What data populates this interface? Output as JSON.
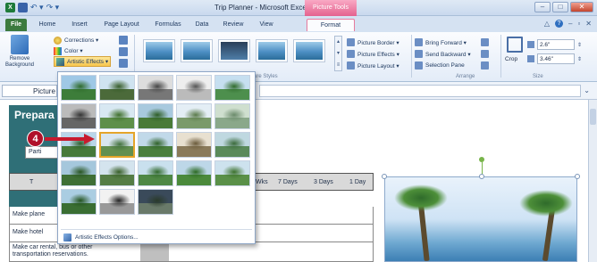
{
  "window": {
    "title": "Trip Planner - Microsoft Excel",
    "context_tab": "Picture Tools",
    "logo_letter": "X"
  },
  "tabs": [
    {
      "label": "File"
    },
    {
      "label": "Home"
    },
    {
      "label": "Insert"
    },
    {
      "label": "Page Layout"
    },
    {
      "label": "Formulas"
    },
    {
      "label": "Data"
    },
    {
      "label": "Review"
    },
    {
      "label": "View"
    },
    {
      "label": "Format"
    }
  ],
  "ribbon": {
    "remove_background": {
      "line1": "Remove",
      "line2": "Background"
    },
    "adjust": {
      "corrections": "Corrections ▾",
      "color": "Color ▾",
      "artistic_effects": "Artistic Effects ▾"
    },
    "styles_label": "ure Styles",
    "arrange_label": "Arrange",
    "size_label": "Size",
    "picture_border": "Picture Border ▾",
    "picture_effects": "Picture Effects ▾",
    "picture_layout": "Picture Layout ▾",
    "bring_forward": "Bring Forward ▾",
    "send_backward": "Send Backward ▾",
    "selection_pane": "Selection Pane",
    "crop": "Crop",
    "height": "2.6\"",
    "width": "3.46\""
  },
  "name_box": "Picture",
  "sheet": {
    "panel_title": "Prepara",
    "partial_button": "Parti",
    "header": {
      "t": "T",
      "wks": "Wks",
      "days7": "7 Days",
      "days3": "3 Days",
      "day1": "1 Day"
    },
    "rows": [
      {
        "task": "Make plane"
      },
      {
        "task": "Make hotel"
      },
      {
        "task": "Make car rental, bus or other transportation reservations."
      }
    ]
  },
  "dropdown": {
    "options_label": "Artistic Effects Options..."
  },
  "callout": {
    "number": "4"
  }
}
